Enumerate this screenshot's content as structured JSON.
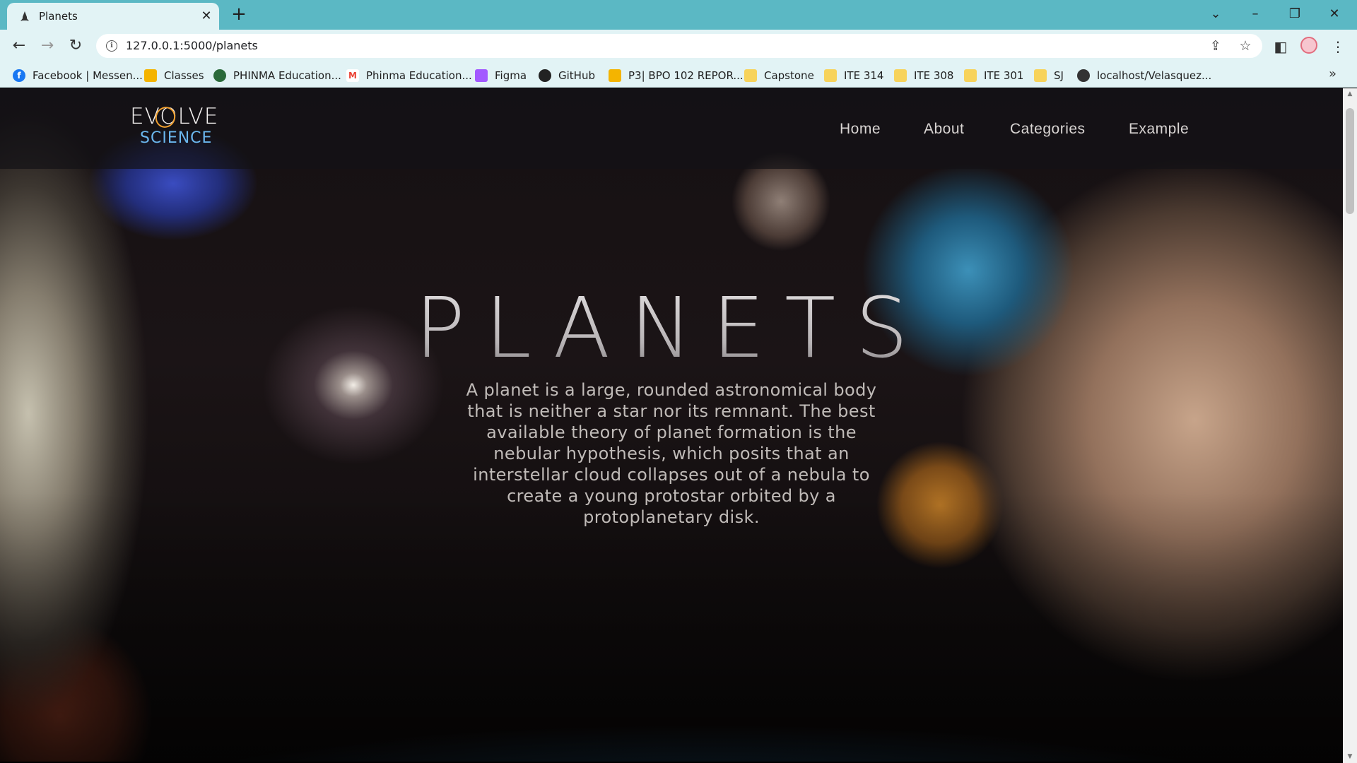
{
  "browser": {
    "tab_title": "Planets",
    "tab_close": "✕",
    "new_tab": "+",
    "url": "127.0.0.1:5000/planets",
    "window_controls": {
      "tab_search": "⌄",
      "minimize": "–",
      "restore": "❐",
      "close": "✕"
    }
  },
  "bookmarks": [
    {
      "label": "Facebook | Messen...",
      "icon": "facebook-icon",
      "color": "#1877f2"
    },
    {
      "label": "Classes",
      "icon": "classroom-icon",
      "color": "#f4b400"
    },
    {
      "label": "PHINMA Education...",
      "icon": "globe-icon",
      "color": "#2a6a3a"
    },
    {
      "label": "Phinma Education...",
      "icon": "gmail-icon",
      "color": "#ea4335"
    },
    {
      "label": "Figma",
      "icon": "figma-icon",
      "color": "#a259ff"
    },
    {
      "label": "GitHub",
      "icon": "github-icon",
      "color": "#222222"
    },
    {
      "label": "P3| BPO 102 REPOR...",
      "icon": "slides-icon",
      "color": "#f4b400"
    },
    {
      "label": "Capstone",
      "icon": "folder-icon",
      "color": "#f7d35b"
    },
    {
      "label": "ITE 314",
      "icon": "folder-icon",
      "color": "#f7d35b"
    },
    {
      "label": "ITE 308",
      "icon": "folder-icon",
      "color": "#f7d35b"
    },
    {
      "label": "ITE 301",
      "icon": "folder-icon",
      "color": "#f7d35b"
    },
    {
      "label": "SJ",
      "icon": "folder-icon",
      "color": "#f7d35b"
    },
    {
      "label": "localhost/Velasquez...",
      "icon": "globe-icon",
      "color": "#333333"
    }
  ],
  "bookmarks_more": "»",
  "site": {
    "logo_top": "EVOLVE",
    "logo_bottom": "SCIENCE",
    "nav": [
      "Home",
      "About",
      "Categories",
      "Example"
    ]
  },
  "hero": {
    "title": "PLANETS",
    "description": "A planet is a large, rounded astronomical body that is neither a star nor its remnant. The best available theory of planet formation is the nebular hypothesis, which posits that an interstellar cloud collapses out of a nebula to create a young protostar orbited by a protoplanetary disk."
  },
  "colors": {
    "chrome": "#5bb8c4",
    "toolbar": "#e2f3f5",
    "logo_accent": "#f0a030",
    "logo_blue": "#6bb7ee"
  }
}
